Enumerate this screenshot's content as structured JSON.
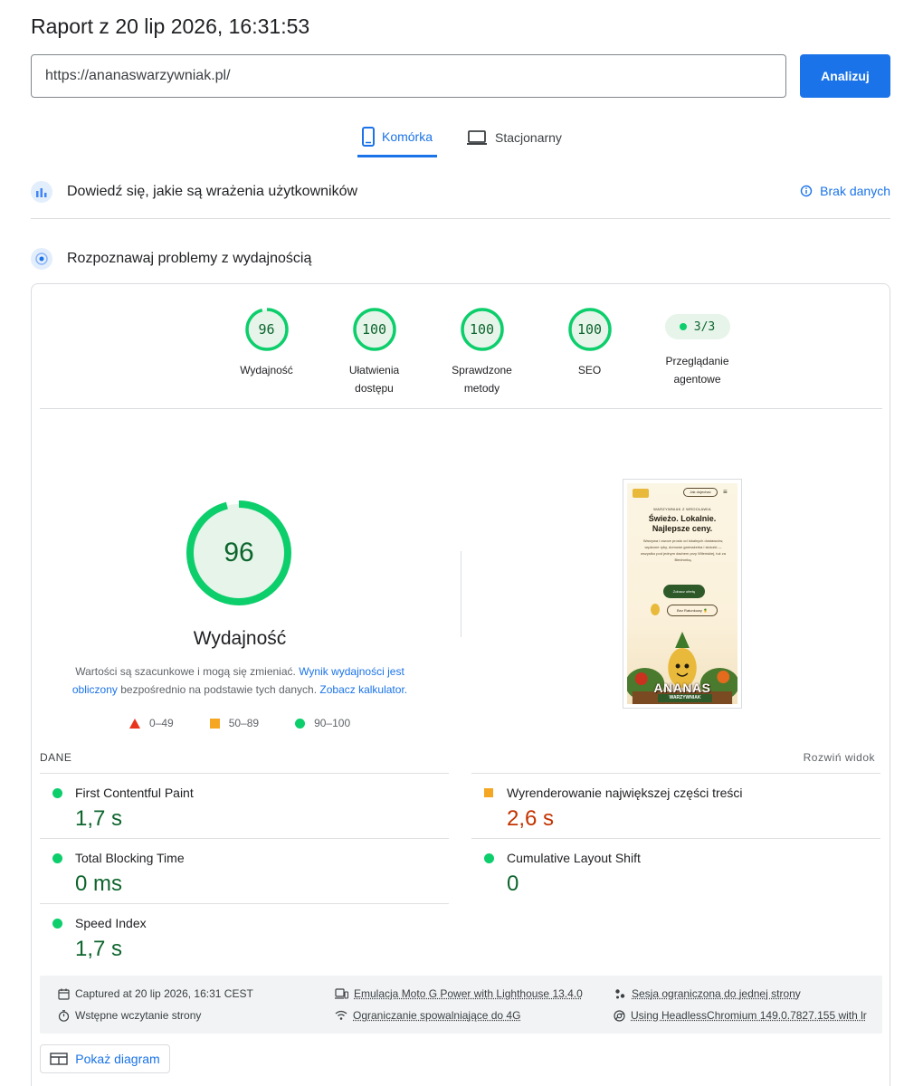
{
  "header": {
    "title": "Raport z 20 lip 2026, 16:31:53",
    "url_value": "https://ananaswarzywniak.pl/",
    "analyze_label": "Analizuj"
  },
  "tabs": [
    {
      "label": "Komórka",
      "icon": "mobile-icon",
      "active": true
    },
    {
      "label": "Stacjonarny",
      "icon": "laptop-icon",
      "active": false
    }
  ],
  "field_data": {
    "title": "Dowiedź się, jakie są wrażenia użytkowników",
    "status": "Brak danych"
  },
  "lab": {
    "title": "Rozpoznawaj problemy z wydajnością"
  },
  "categories": [
    {
      "score": "96",
      "label": "Wydajność",
      "fraction": 0.96
    },
    {
      "score": "100",
      "label": "Ułatwienia dostępu",
      "fraction": 1.0
    },
    {
      "score": "100",
      "label": "Sprawdzone metody",
      "fraction": 1.0
    },
    {
      "score": "100",
      "label": "SEO",
      "fraction": 1.0
    },
    {
      "score": "3/3",
      "label": "Przeglądanie agentowe",
      "type": "pill"
    }
  ],
  "performance": {
    "score": "96",
    "fraction": 0.96,
    "label": "Wydajność",
    "disclaimer": {
      "part1": "Wartości są szacunkowe i mogą się zmieniać. ",
      "link1": "Wynik wydajności jest obliczony",
      "part2": " bezpośrednio na podstawie tych danych. ",
      "link2": "Zobacz kalkulator."
    },
    "legend": [
      "0–49",
      "50–89",
      "90–100"
    ]
  },
  "screenshot": {
    "button": "Jak dojechać",
    "eyebrow": "WARZYWNIAK Z WROCŁAWIA",
    "headline_1": "Świeżo. Lokalnie.",
    "headline_2": "Najlepsze ceny.",
    "body": "Warzywa i owoce prosto od lokalnych dostawców, wędzone ryby, domowe garmażerka i słoiczki — wszystko pod jednym dachem przy Wileńskiej, tuż za Biedronką.",
    "cta": "Zobacz ofertę",
    "cta2": "Bez Ratunkowy 🍍",
    "brand": "ANANAS",
    "brand_sub": "WARZYWNIAK"
  },
  "metrics_header": {
    "label": "DANE",
    "expand": "Rozwiń widok"
  },
  "metrics": [
    {
      "name": "First Contentful Paint",
      "value": "1,7 s",
      "rating": "good"
    },
    {
      "name": "Wyrenderowanie największej części treści",
      "value": "2,6 s",
      "rating": "average"
    },
    {
      "name": "Total Blocking Time",
      "value": "0 ms",
      "rating": "good"
    },
    {
      "name": "Cumulative Layout Shift",
      "value": "0",
      "rating": "good"
    },
    {
      "name": "Speed Index",
      "value": "1,7 s",
      "rating": "good"
    }
  ],
  "footer": {
    "captured": "Captured at 20 lip 2026, 16:31 CEST",
    "initial_load": "Wstępne wczytanie strony",
    "emulation": "Emulacja Moto G Power with Lighthouse 13.4.0",
    "throttling": "Ograniczanie spowalniające do 4G",
    "session": "Sesja ograniczona do jednej strony",
    "browser": "Using HeadlessChromium 149.0.7827.155 with lr"
  },
  "diagram_label": "Pokaż diagram",
  "colors": {
    "accent": "#1a73e8",
    "good": "#0cce6b",
    "good_text": "#0d652d",
    "average": "#f5a623",
    "average_text": "#c33300",
    "poor": "#e8341c"
  }
}
